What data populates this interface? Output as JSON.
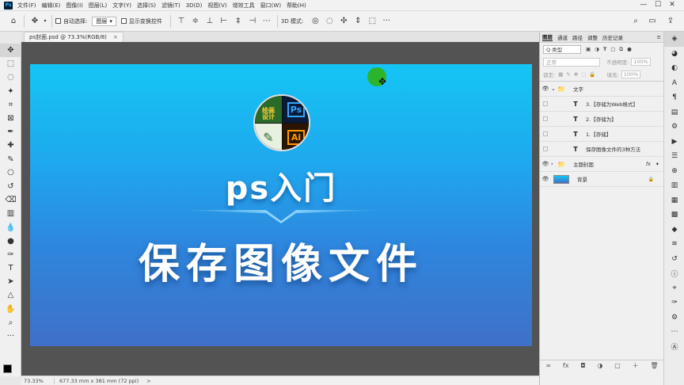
{
  "app": {
    "logo": "Ps",
    "menus": [
      "文件(F)",
      "编辑(E)",
      "图像(I)",
      "图层(L)",
      "文字(Y)",
      "选择(S)",
      "滤镜(T)",
      "3D(D)",
      "视图(V)",
      "增效工具",
      "窗口(W)",
      "帮助(H)"
    ],
    "window_controls": [
      "—",
      "☐",
      "✕"
    ]
  },
  "options": {
    "auto_select": "自动选择:",
    "layer_dropdown": "图层",
    "show_transform": "显示变换控件",
    "mode_3d": "3D 模式:"
  },
  "document": {
    "tab_title": "ps封面.psd @ 73.3%(RGB/8)",
    "close": "×"
  },
  "canvas": {
    "title1": "ps入门",
    "title2": "保存图像文件",
    "logo_tl": "绘画\n设计",
    "logo_tr": "Ps",
    "logo_br": "Ai"
  },
  "status": {
    "zoom": "73.33%",
    "size": "677.33 mm x 381 mm (72 ppi)",
    "arrow": ">"
  },
  "panel": {
    "tabs": [
      "图层",
      "通道",
      "路径",
      "调整",
      "历史记录"
    ],
    "filter_label": "Q 类型",
    "blend_mode": "正常",
    "opacity_label": "不透明度:",
    "opacity_value": "100%",
    "lock_label": "锁定:",
    "fill_label": "填充:",
    "fill_value": "100%",
    "layers": [
      {
        "name": "文字",
        "type": "group",
        "visible": true,
        "indent": 0
      },
      {
        "name": "3.【存储为Web格式】",
        "type": "text",
        "visible": false,
        "indent": 1
      },
      {
        "name": "2.【存储为】",
        "type": "text",
        "visible": false,
        "indent": 1
      },
      {
        "name": "1.【存储】",
        "type": "text",
        "visible": false,
        "indent": 1
      },
      {
        "name": "保存图像文件的3种方法",
        "type": "text",
        "visible": false,
        "indent": 1
      },
      {
        "name": "主题封面",
        "type": "group",
        "visible": true,
        "indent": 0,
        "fx": "fx"
      },
      {
        "name": "背景",
        "type": "bg",
        "visible": true,
        "indent": 0,
        "lock": "🔒"
      }
    ],
    "footer_icons": [
      "∞",
      "fx",
      "◘",
      "◑",
      "▢",
      "＋",
      "🗑"
    ]
  },
  "colors": {
    "accent": "#31a8ff",
    "canvas_top": "#15c5f4",
    "canvas_bottom": "#4070c8",
    "green_cursor": "#2bb52b"
  }
}
